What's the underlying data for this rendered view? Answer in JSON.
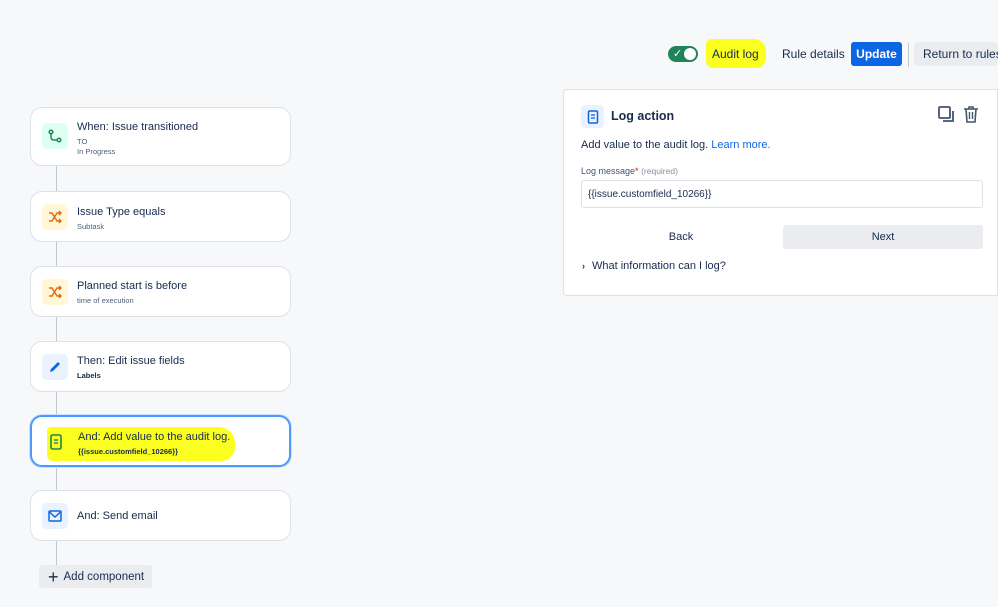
{
  "toolbar": {
    "audit_log": "Audit log",
    "rule_details": "Rule details",
    "update": "Update",
    "return_to_rules": "Return to rules",
    "enabled": true
  },
  "rule_components": [
    {
      "title": "When: Issue transitioned",
      "sub1": "TO",
      "sub2": "In Progress",
      "icon": "branch-arrow-icon",
      "icon_color": "#1f845a"
    },
    {
      "title": "Issue Type equals",
      "sub1": "Subtask",
      "icon": "shuffle-condition-icon",
      "icon_color": "#e56910"
    },
    {
      "title": "Planned start is before",
      "sub1": "time of execution",
      "icon": "shuffle-condition-icon",
      "icon_color": "#e56910"
    },
    {
      "title": "Then: Edit issue fields",
      "sub1": "Labels",
      "icon": "pencil-icon",
      "icon_color": "#0c66e4"
    },
    {
      "title": "And: Add value to the audit log.",
      "sub1": "{{issue.customfield_10266}}",
      "icon": "log-document-icon",
      "icon_color": "#1f845a"
    },
    {
      "title": "And: Send email",
      "icon": "mail-icon",
      "icon_color": "#0c66e4"
    }
  ],
  "add_component": "Add component",
  "panel": {
    "title": "Log action",
    "description": "Add value to the audit log.",
    "learn_more": "Learn more.",
    "field_label": "Log message",
    "required_mark": "*",
    "required_hint": "(required)",
    "field_value": "{{issue.customfield_10266}}",
    "back": "Back",
    "next": "Next",
    "expander": "What information can I log?"
  },
  "colors": {
    "highlight": "#fbff1f",
    "primary": "#0c66e4",
    "toggle_on": "#1f845a"
  }
}
